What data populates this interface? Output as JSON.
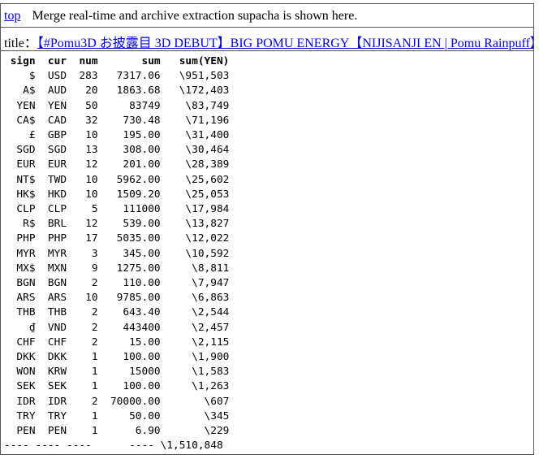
{
  "top_link": "top",
  "message": "Merge real-time and archive extraction supacha is shown here.",
  "title_label": "title：",
  "title_link": "【#Pomu3D お披露目 3D DEBUT】BIG POMU ENERGY【NIJISANJI EN | Pomu Rainpuff】",
  "table": {
    "headers": [
      "sign",
      "cur",
      "num",
      "sum",
      "sum(YEN)"
    ],
    "rows": [
      [
        "$",
        "USD",
        "283",
        "7317.06",
        "\\951,503"
      ],
      [
        "A$",
        "AUD",
        "20",
        "1863.68",
        "\\172,403"
      ],
      [
        "YEN",
        "YEN",
        "50",
        "83749",
        "\\83,749"
      ],
      [
        "CA$",
        "CAD",
        "32",
        "730.48",
        "\\71,196"
      ],
      [
        "£",
        "GBP",
        "10",
        "195.00",
        "\\31,400"
      ],
      [
        "SGD",
        "SGD",
        "13",
        "308.00",
        "\\30,464"
      ],
      [
        "EUR",
        "EUR",
        "12",
        "201.00",
        "\\28,389"
      ],
      [
        "NT$",
        "TWD",
        "10",
        "5962.00",
        "\\25,602"
      ],
      [
        "HK$",
        "HKD",
        "10",
        "1509.20",
        "\\25,053"
      ],
      [
        "CLP",
        "CLP",
        "5",
        "111000",
        "\\17,984"
      ],
      [
        "R$",
        "BRL",
        "12",
        "539.00",
        "\\13,827"
      ],
      [
        "PHP",
        "PHP",
        "17",
        "5035.00",
        "\\12,022"
      ],
      [
        "MYR",
        "MYR",
        "3",
        "345.00",
        "\\10,592"
      ],
      [
        "MX$",
        "MXN",
        "9",
        "1275.00",
        "\\8,811"
      ],
      [
        "BGN",
        "BGN",
        "2",
        "110.00",
        "\\7,947"
      ],
      [
        "ARS",
        "ARS",
        "10",
        "9785.00",
        "\\6,863"
      ],
      [
        "THB",
        "THB",
        "2",
        "643.40",
        "\\2,544"
      ],
      [
        "₫",
        "VND",
        "2",
        "443400",
        "\\2,457"
      ],
      [
        "CHF",
        "CHF",
        "2",
        "15.00",
        "\\2,115"
      ],
      [
        "DKK",
        "DKK",
        "1",
        "100.00",
        "\\1,900"
      ],
      [
        "WON",
        "KRW",
        "1",
        "15000",
        "\\1,583"
      ],
      [
        "SEK",
        "SEK",
        "1",
        "100.00",
        "\\1,263"
      ],
      [
        "IDR",
        "IDR",
        "2",
        "70000.00",
        "\\607"
      ],
      [
        "TRY",
        "TRY",
        "1",
        "50.00",
        "\\345"
      ],
      [
        "PEN",
        "PEN",
        "1",
        "6.90",
        "\\229"
      ]
    ],
    "footer_dashes": "----",
    "total": "\\1,510,848"
  }
}
